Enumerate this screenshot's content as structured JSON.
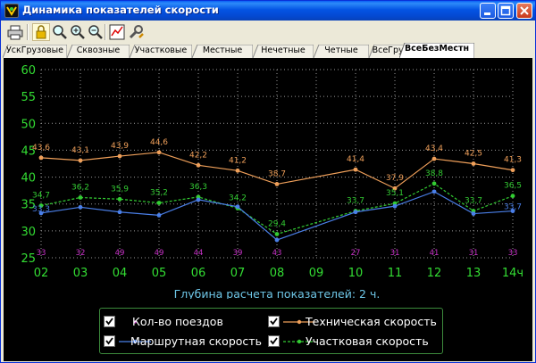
{
  "window": {
    "title": "Динамика показателей скорости"
  },
  "toolbar": {
    "items": [
      "print-icon",
      "lock-icon",
      "zoom-icon",
      "zoom-in-icon",
      "zoom-out-icon",
      "chart-icon",
      "settings-icon"
    ]
  },
  "tabs": [
    {
      "label": "УскГрузовые",
      "active": false
    },
    {
      "label": "Сквозные",
      "active": false
    },
    {
      "label": "Участковые",
      "active": false
    },
    {
      "label": "Местные",
      "active": false
    },
    {
      "label": "Нечетные",
      "active": false
    },
    {
      "label": "Четные",
      "active": false
    },
    {
      "label": "ВсеГрузовые",
      "active": false
    },
    {
      "label": "ВсеБезМестн",
      "active": true
    }
  ],
  "chart_data": {
    "type": "line",
    "categories": [
      "02",
      "03",
      "04",
      "05",
      "06",
      "07",
      "08",
      "09",
      "10",
      "11",
      "12",
      "13",
      "14ч"
    ],
    "ylim": [
      25,
      60
    ],
    "yticks": [
      25,
      30,
      35,
      40,
      45,
      50,
      55,
      60
    ],
    "xlabel": "Глубина расчета показателей: 2 ч.",
    "grid": true,
    "series": [
      {
        "name": "Техническая скорость",
        "color": "#f0a05a",
        "style": "solid",
        "values": [
          43.6,
          43.1,
          43.9,
          44.6,
          42.2,
          41.2,
          38.7,
          null,
          41.4,
          37.9,
          43.4,
          42.5,
          41.3
        ],
        "labels": [
          "43,6",
          "43,1",
          "43,9",
          "44,6",
          "42,2",
          "41,2",
          "38,7",
          null,
          "41,4",
          "37,9",
          "43,4",
          "42,5",
          "41,3"
        ]
      },
      {
        "name": "Участковая скорость",
        "color": "#33cc33",
        "style": "dashed",
        "values": [
          34.7,
          36.2,
          35.9,
          35.2,
          36.3,
          34.2,
          29.4,
          null,
          33.7,
          35.1,
          38.8,
          33.7,
          36.5
        ],
        "labels": [
          "34,7",
          "36,2",
          "35,9",
          "35,2",
          "36,3",
          "34,2",
          "29,4",
          null,
          "33,7",
          "35,1",
          "38,8",
          "33,7",
          "36,5"
        ]
      },
      {
        "name": "Маршрутная скорость",
        "color": "#4a7fe8",
        "style": "solid",
        "values": [
          33.3,
          34.4,
          33.5,
          32.9,
          35.8,
          34.5,
          28.3,
          null,
          33.5,
          34.6,
          37.3,
          33.2,
          33.7
        ],
        "labels": [
          "33,3",
          null,
          null,
          null,
          null,
          null,
          null,
          null,
          null,
          null,
          null,
          null,
          "33,7"
        ]
      },
      {
        "name": "Кол-во поездов",
        "color": "#cc33cc",
        "style": "points",
        "labels": [
          "33",
          "32",
          "49",
          "49",
          "44",
          "39",
          "43",
          null,
          "27",
          "31",
          "41",
          "31",
          "33"
        ]
      }
    ]
  },
  "legend": [
    {
      "label": "Кол-во поездов",
      "checked": true,
      "series": 3
    },
    {
      "label": "Техническая скорость",
      "checked": true,
      "series": 0
    },
    {
      "label": "Маршрутная скорость",
      "checked": true,
      "series": 2
    },
    {
      "label": "Участковая скорость",
      "checked": true,
      "series": 1
    }
  ]
}
